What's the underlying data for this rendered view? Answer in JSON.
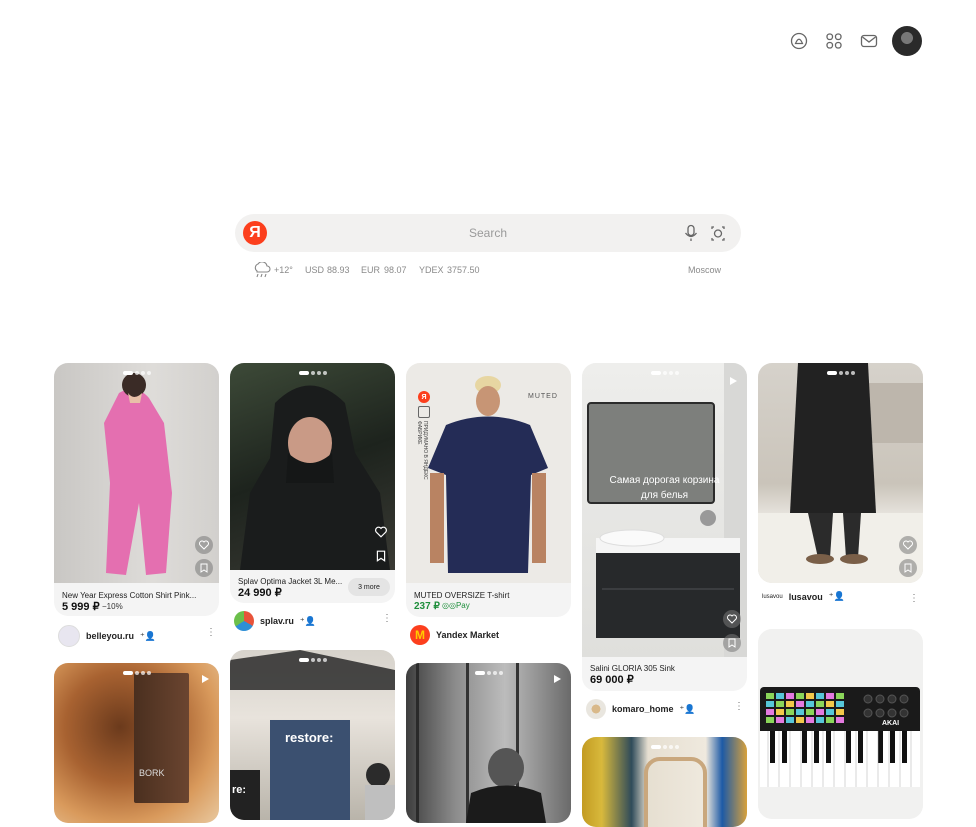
{
  "header": {
    "icons": [
      "alice-icon",
      "apps-grid-icon",
      "mail-icon"
    ],
    "avatar": "user-avatar"
  },
  "search": {
    "logo": "Я",
    "placeholder": "Search",
    "icons": [
      "microphone-icon",
      "camera-search-icon"
    ]
  },
  "info": {
    "weather": "+12°",
    "usd_label": "USD",
    "usd": "88.93",
    "eur_label": "EUR",
    "eur": "98.07",
    "ydex_label": "YDEX",
    "ydex": "3757.50",
    "city": "Moscow"
  },
  "feed": {
    "cards": [
      {
        "title": "New Year Express Cotton Shirt Pink...",
        "price": "5 999 ₽",
        "discount": "−10%",
        "author": "belleyou.ru"
      },
      {
        "title": "Splav Optima Jacket 3L Me...",
        "price": "24 990 ₽",
        "more": "3 more",
        "author": "splav.ru"
      },
      {
        "brand": "MUTED",
        "title": "MUTED OVERSIZE T-shirt",
        "price": "237 ₽",
        "pay": "Pay",
        "author": "Yandex Market",
        "side_text": "ПРИДУМАНО В ЯНДЕКС ФАБРИКЕ"
      },
      {
        "overlay": "Самая дорогая корзина для белья",
        "title": "Salini GLORIA 305 Sink",
        "price": "69 000 ₽",
        "author": "komaro_home"
      },
      {
        "author_logo": "lusavou",
        "author": "lusavou"
      },
      {
        "brand": "BORK"
      },
      {
        "store": "restore:",
        "store_partial": "re:"
      },
      {},
      {},
      {
        "brand": "AKAI"
      }
    ]
  }
}
